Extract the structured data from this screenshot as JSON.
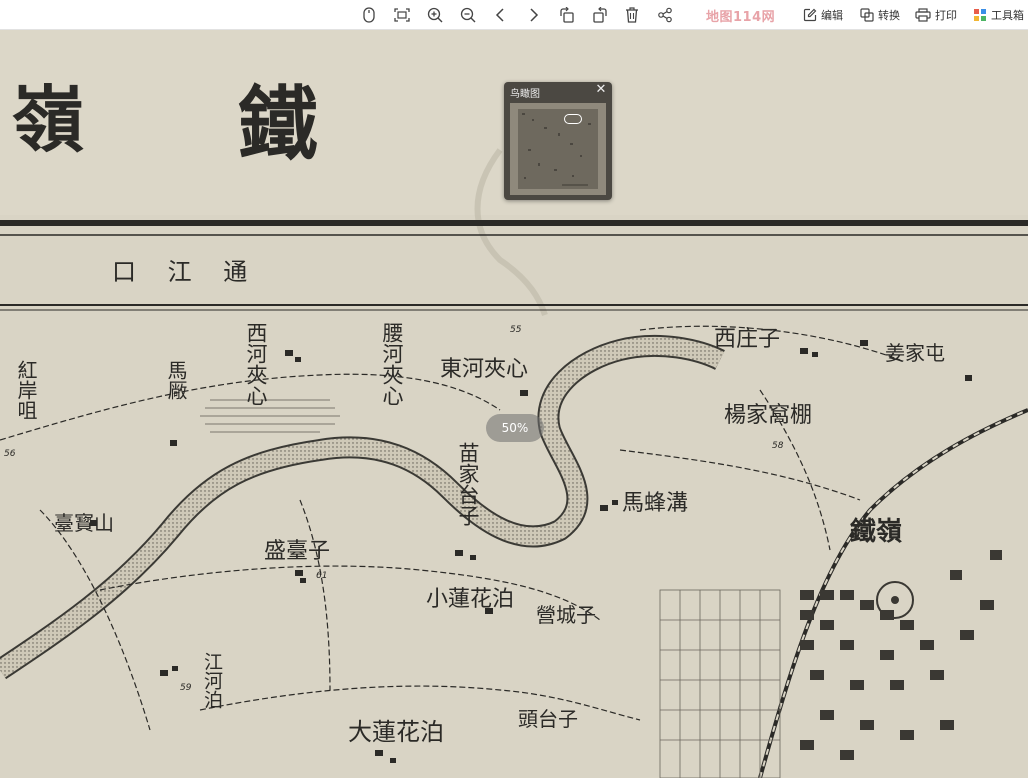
{
  "toolbar": {
    "brand": "地图114网",
    "actions": [
      {
        "label": "编辑",
        "icon": "edit-icon"
      },
      {
        "label": "转换",
        "icon": "convert-icon"
      },
      {
        "label": "打印",
        "icon": "print-icon"
      },
      {
        "label": "工具箱",
        "icon": "toolbox-icon"
      }
    ],
    "icons": [
      "mouse-icon",
      "fit-screen-icon",
      "zoom-in-icon",
      "zoom-out-icon",
      "previous-icon",
      "next-icon",
      "rotate-left-icon",
      "rotate-right-icon",
      "delete-icon",
      "share-icon"
    ]
  },
  "overview": {
    "title": "鸟瞰图"
  },
  "zoom": {
    "label": "50%"
  },
  "map": {
    "header_chars": [
      "嶺",
      "鐵"
    ],
    "region_title": "口 江 通",
    "places": [
      {
        "name": "紅岸咀"
      },
      {
        "name": "馬厰"
      },
      {
        "name": "西河夾心"
      },
      {
        "name": "腰河夾心"
      },
      {
        "name": "東河夾心"
      },
      {
        "name": "西庄子"
      },
      {
        "name": "姜家屯"
      },
      {
        "name": "楊家窩棚"
      },
      {
        "name": "苗家台子"
      },
      {
        "name": "馬蜂溝"
      },
      {
        "name": "臺寳山"
      },
      {
        "name": "盛臺子"
      },
      {
        "name": "小蓮花泊"
      },
      {
        "name": "營城子"
      },
      {
        "name": "江河泊"
      },
      {
        "name": "頭台子"
      },
      {
        "name": "大蓮花泊"
      },
      {
        "name": "鐵嶺"
      }
    ],
    "elevations": [
      "55",
      "58",
      "56",
      "61",
      "59"
    ]
  },
  "colors": {
    "paper": "#d9d4c6",
    "ink": "#2b2a27",
    "brand": "#e8a3a8"
  }
}
